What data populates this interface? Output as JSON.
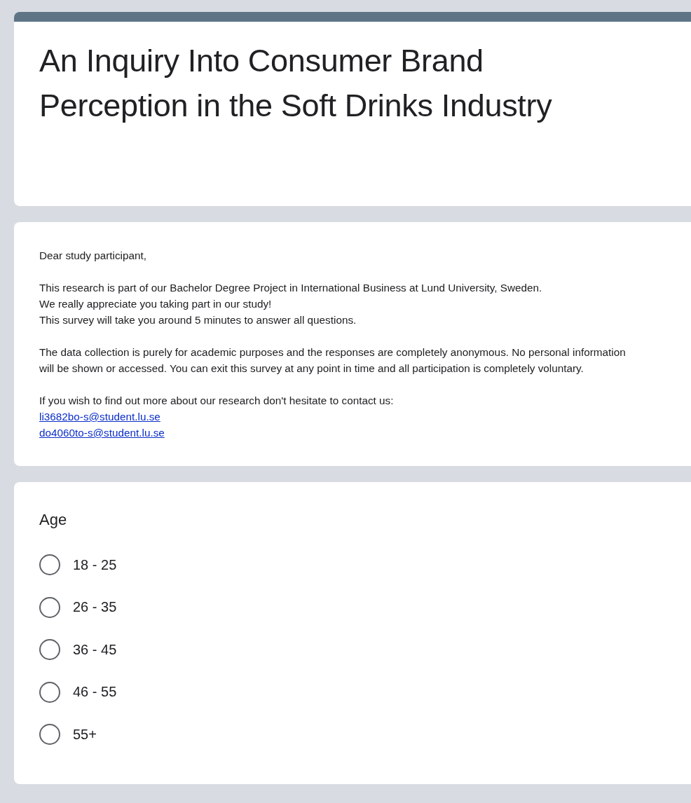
{
  "form": {
    "title": "An Inquiry Into Consumer Brand Perception in the Soft Drinks Industry"
  },
  "description": {
    "blocks": [
      {
        "lines": [
          "Dear study participant,"
        ]
      },
      {
        "lines": [
          "This research is part of our Bachelor Degree Project in International Business at Lund University, Sweden.",
          "We really appreciate you taking part in our study!",
          "This survey will take you around 5 minutes to answer all questions."
        ]
      },
      {
        "lines": [
          "The data collection is purely for academic purposes and the responses are completely anonymous. No personal information will be shown or accessed. You can exit this survey at any point in time and all participation is completely voluntary."
        ]
      },
      {
        "lines": [
          "If you wish to find out more about our research don't hesitate to contact us:"
        ],
        "links": [
          "li3682bo-s@student.lu.se",
          "do4060to-s@student.lu.se"
        ]
      }
    ]
  },
  "question": {
    "title": "Age",
    "options": [
      {
        "label": "18 - 25",
        "selected": false
      },
      {
        "label": "26 - 35",
        "selected": false
      },
      {
        "label": "36 - 45",
        "selected": false
      },
      {
        "label": "46 - 55",
        "selected": false
      },
      {
        "label": "55+",
        "selected": false
      }
    ]
  }
}
